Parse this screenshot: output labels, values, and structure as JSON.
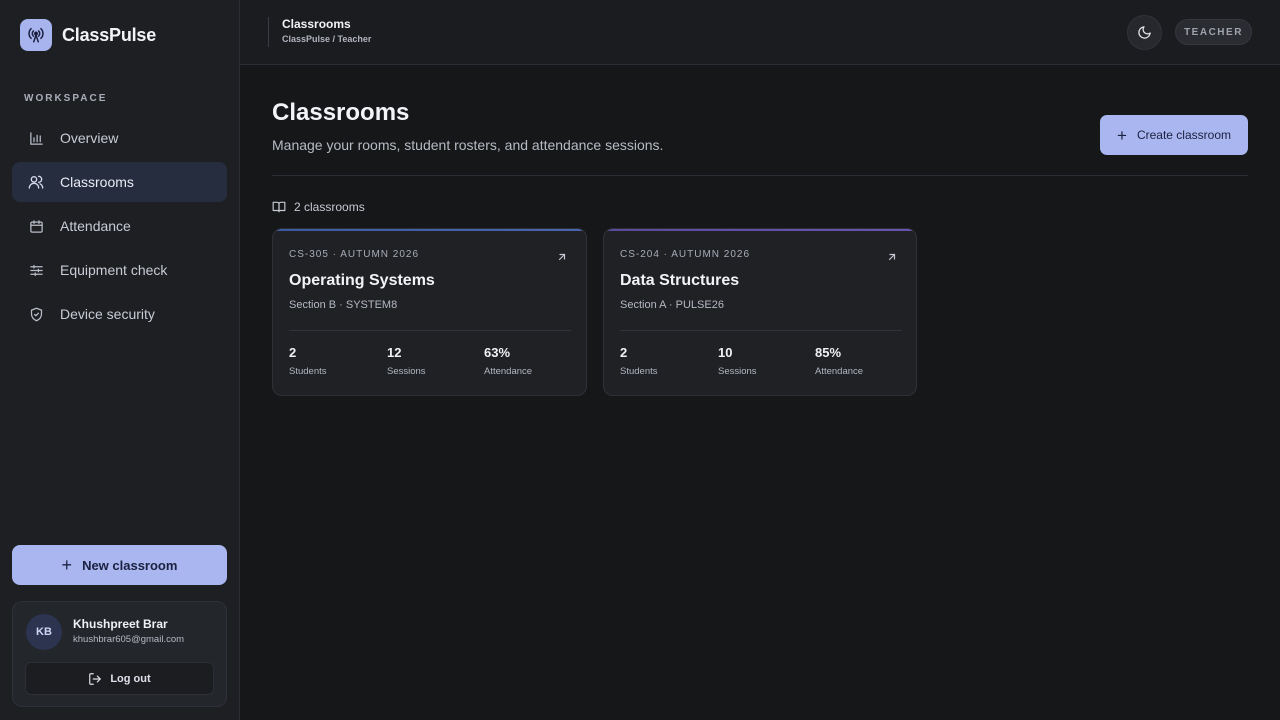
{
  "brand": {
    "name": "ClassPulse",
    "logo_icon": "broadcast-icon"
  },
  "sidebar": {
    "section_label": "WORKSPACE",
    "items": [
      {
        "label": "Overview",
        "icon": "bar-chart-icon",
        "active": false
      },
      {
        "label": "Classrooms",
        "icon": "users-icon",
        "active": true
      },
      {
        "label": "Attendance",
        "icon": "calendar-icon",
        "active": false
      },
      {
        "label": "Equipment check",
        "icon": "sliders-icon",
        "active": false
      },
      {
        "label": "Device security",
        "icon": "shield-icon",
        "active": false
      }
    ],
    "new_button": "New classroom",
    "user": {
      "initials": "KB",
      "name": "Khushpreet Brar",
      "email": "khushbrar605@gmail.com",
      "logout_label": "Log out"
    }
  },
  "topbar": {
    "title": "Classrooms",
    "breadcrumb": "ClassPulse / Teacher",
    "role_badge": "TEACHER"
  },
  "main": {
    "title": "Classrooms",
    "subtitle": "Manage your rooms, student rosters, and attendance sessions.",
    "create_button": "Create classroom",
    "count_label": "2 classrooms",
    "cards": [
      {
        "code": "CS-305 · AUTUMN 2026",
        "title": "Operating Systems",
        "section": "Section B · SYSTEM8",
        "accent": "#3f5fa8",
        "stats": [
          {
            "value": "2",
            "label": "Students"
          },
          {
            "value": "12",
            "label": "Sessions"
          },
          {
            "value": "63%",
            "label": "Attendance"
          }
        ]
      },
      {
        "code": "CS-204 · AUTUMN 2026",
        "title": "Data Structures",
        "section": "Section A · PULSE26",
        "accent": "#6a4fa8",
        "stats": [
          {
            "value": "2",
            "label": "Students"
          },
          {
            "value": "10",
            "label": "Sessions"
          },
          {
            "value": "85%",
            "label": "Attendance"
          }
        ]
      }
    ]
  },
  "colors": {
    "accent": "#a9b6ef",
    "background": "#161719",
    "sidebar": "#1d1f23"
  }
}
